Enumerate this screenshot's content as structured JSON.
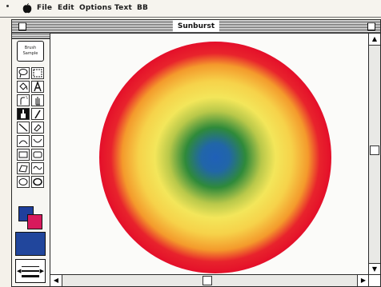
{
  "menubar": {
    "items": [
      "File",
      "Edit",
      "Options",
      "Text",
      "BB"
    ]
  },
  "window": {
    "title": "Sunburst"
  },
  "palette": {
    "brush_sample_text": "Brush\nSample"
  },
  "colors": {
    "foreground": "#1f3f9c",
    "background": "#d8195c",
    "current_fill": "#21469c",
    "gradient": [
      "#1f60b8",
      "#2f8a3a",
      "#e8e24a",
      "#f5a22a",
      "#e8102a"
    ]
  },
  "icons": [
    "apple-icon",
    "close-box-icon",
    "zoom-box-icon",
    "lasso-icon",
    "marquee-icon",
    "bucket-icon",
    "text-icon",
    "spray-icon",
    "hand-icon",
    "brush-icon",
    "pencil-icon",
    "line-icon",
    "eraser-icon",
    "rectangle-icon",
    "rounded-rect-icon",
    "oval-icon",
    "polygon-icon"
  ]
}
